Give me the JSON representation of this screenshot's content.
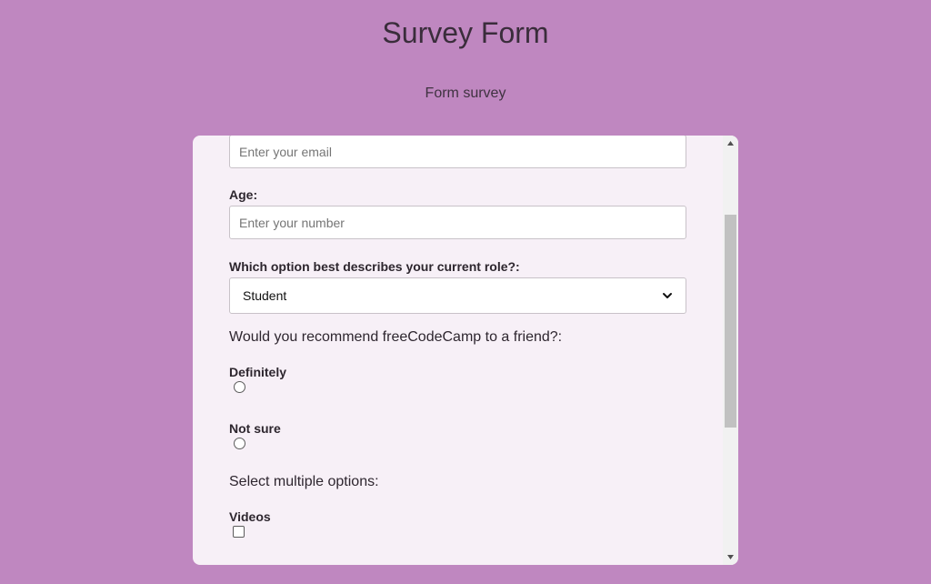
{
  "header": {
    "title": "Survey Form",
    "subtitle": "Form survey"
  },
  "form": {
    "email": {
      "placeholder": "Enter your email",
      "value": ""
    },
    "age": {
      "label": "Age:",
      "placeholder": "Enter your number",
      "value": ""
    },
    "role": {
      "label": "Which option best describes your current role?:",
      "selected": "Student"
    },
    "recommend": {
      "question": "Would you recommend freeCodeCamp to a friend?:",
      "options": [
        {
          "label": "Definitely",
          "checked": false
        },
        {
          "label": "Not sure",
          "checked": false
        }
      ]
    },
    "multi": {
      "question": "Select multiple options:",
      "options": [
        {
          "label": "Videos",
          "checked": false
        }
      ]
    }
  },
  "colors": {
    "page_background": "#bf87c0",
    "card_background": "#f7f0f7",
    "text": "#3a2d3b"
  },
  "icons": {
    "select": "chevron-down-icon",
    "scroll_up": "scroll-up-arrow-icon",
    "scroll_down": "scroll-down-arrow-icon"
  }
}
